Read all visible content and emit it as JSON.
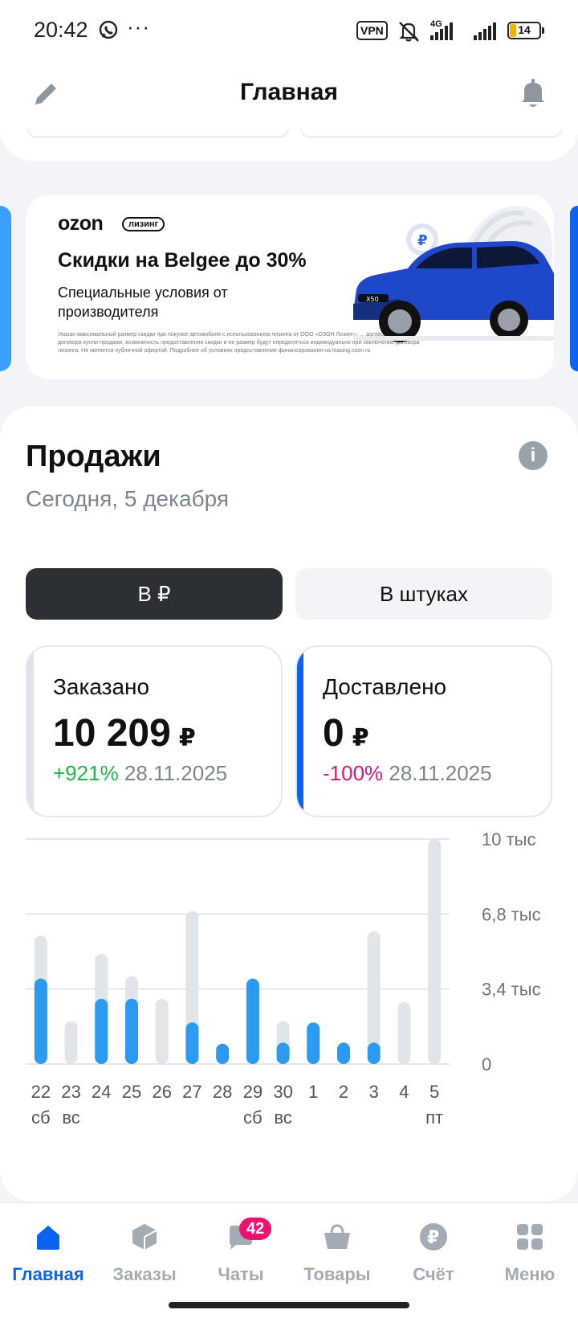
{
  "status_bar": {
    "time": "20:42",
    "dots": "···",
    "vpn": "VPN",
    "network": "4G",
    "battery": "14"
  },
  "header": {
    "title": "Главная"
  },
  "banner": {
    "logo": "ozon",
    "tag": "лизинг",
    "headline": "Скидки на Belgee до 30%",
    "subtitle": "Специальные условия от производителя",
    "fine_print": "Указан максимальный размер скидки при покупке автомобиля с использованием лизинга от ООО «ОЗОН Лизинг». ... договора лизинга, договора купли-продажи, возможность предоставления скидки и ее размер будут определяться индивидуально при заключении договора лизинга. Не является публичной офертой. Подробнее об условиях предоставления финансирования на leasing.ozon.ru",
    "car_badge": "X50"
  },
  "sales": {
    "title": "Продажи",
    "date": "Сегодня, 5 декабря",
    "toggle": {
      "rub_label": "В ₽",
      "units_label": "В штуках",
      "selected": "rub"
    },
    "ordered": {
      "label": "Заказано",
      "value": "10 209",
      "currency": "₽",
      "delta": "+921%",
      "compare_date": "28.11.2025",
      "accent": "#dfe3e9"
    },
    "delivered": {
      "label": "Доставлено",
      "value": "0",
      "currency": "₽",
      "delta": "-100%",
      "compare_date": "28.11.2025",
      "accent": "#0a64f0"
    }
  },
  "chart_data": {
    "type": "bar",
    "categories": [
      "22",
      "23",
      "24",
      "25",
      "26",
      "27",
      "28",
      "29",
      "30",
      "1",
      "2",
      "3",
      "4",
      "5"
    ],
    "weekday_labels": [
      "сб",
      "вс",
      "",
      "",
      "",
      "",
      "",
      "сб",
      "вс",
      "",
      "",
      "",
      "",
      "пт"
    ],
    "series": [
      {
        "values": [
          5700,
          1900,
          4900,
          3900,
          2900,
          6800,
          0,
          0,
          1900,
          0,
          0,
          5900,
          2750,
          10000
        ],
        "color": "#e1e4e8"
      },
      {
        "values": [
          3800,
          0,
          2900,
          2900,
          0,
          1850,
          900,
          3800,
          950,
          1850,
          950,
          950,
          0,
          0
        ],
        "color": "#2b9af0"
      }
    ],
    "y_ticks": [
      "10 тыс",
      "6,8 тыс",
      "3,4 тыс",
      "0"
    ],
    "ylim": [
      0,
      10000
    ],
    "grid": true
  },
  "nav": {
    "items": [
      {
        "label": "Главная",
        "icon": "home-icon",
        "active": true
      },
      {
        "label": "Заказы",
        "icon": "box-icon",
        "active": false
      },
      {
        "label": "Чаты",
        "icon": "chat-icon",
        "active": false,
        "badge": "42"
      },
      {
        "label": "Товары",
        "icon": "basket-icon",
        "active": false
      },
      {
        "label": "Счёт",
        "icon": "ruble-coin-icon",
        "active": false
      },
      {
        "label": "Меню",
        "icon": "grid-menu-icon",
        "active": false
      }
    ]
  },
  "colors": {
    "accent": "#0a64f0",
    "positive": "#1fb84a",
    "negative": "#d6197a",
    "bar_primary": "#2b9af0",
    "bar_secondary": "#e1e4e8"
  }
}
